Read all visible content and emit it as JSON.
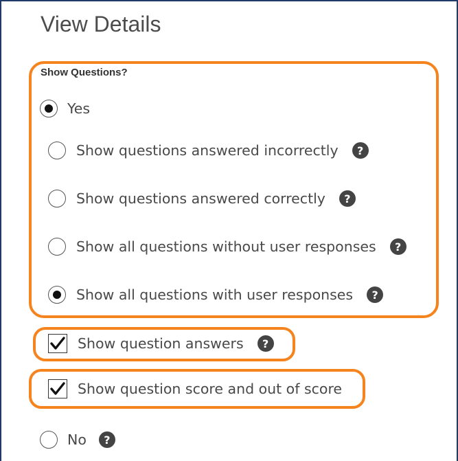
{
  "title": "View Details",
  "section_label": "Show Questions?",
  "options": {
    "yes": {
      "label": "Yes",
      "selected": true
    },
    "incorrect": {
      "label": "Show questions answered incorrectly",
      "selected": false
    },
    "correct": {
      "label": "Show questions answered correctly",
      "selected": false
    },
    "without_responses": {
      "label": "Show all questions without user responses",
      "selected": false
    },
    "with_responses": {
      "label": "Show all questions with user responses",
      "selected": true
    },
    "show_answers": {
      "label": "Show question answers",
      "checked": true
    },
    "show_score": {
      "label": "Show question score and out of score",
      "checked": true
    },
    "no": {
      "label": "No",
      "selected": false
    }
  },
  "help_icon_glyph": "?",
  "checkmark_glyph": "✔",
  "colors": {
    "highlight": "#f5841f",
    "frame": "#1f3a68",
    "text": "#494949"
  }
}
